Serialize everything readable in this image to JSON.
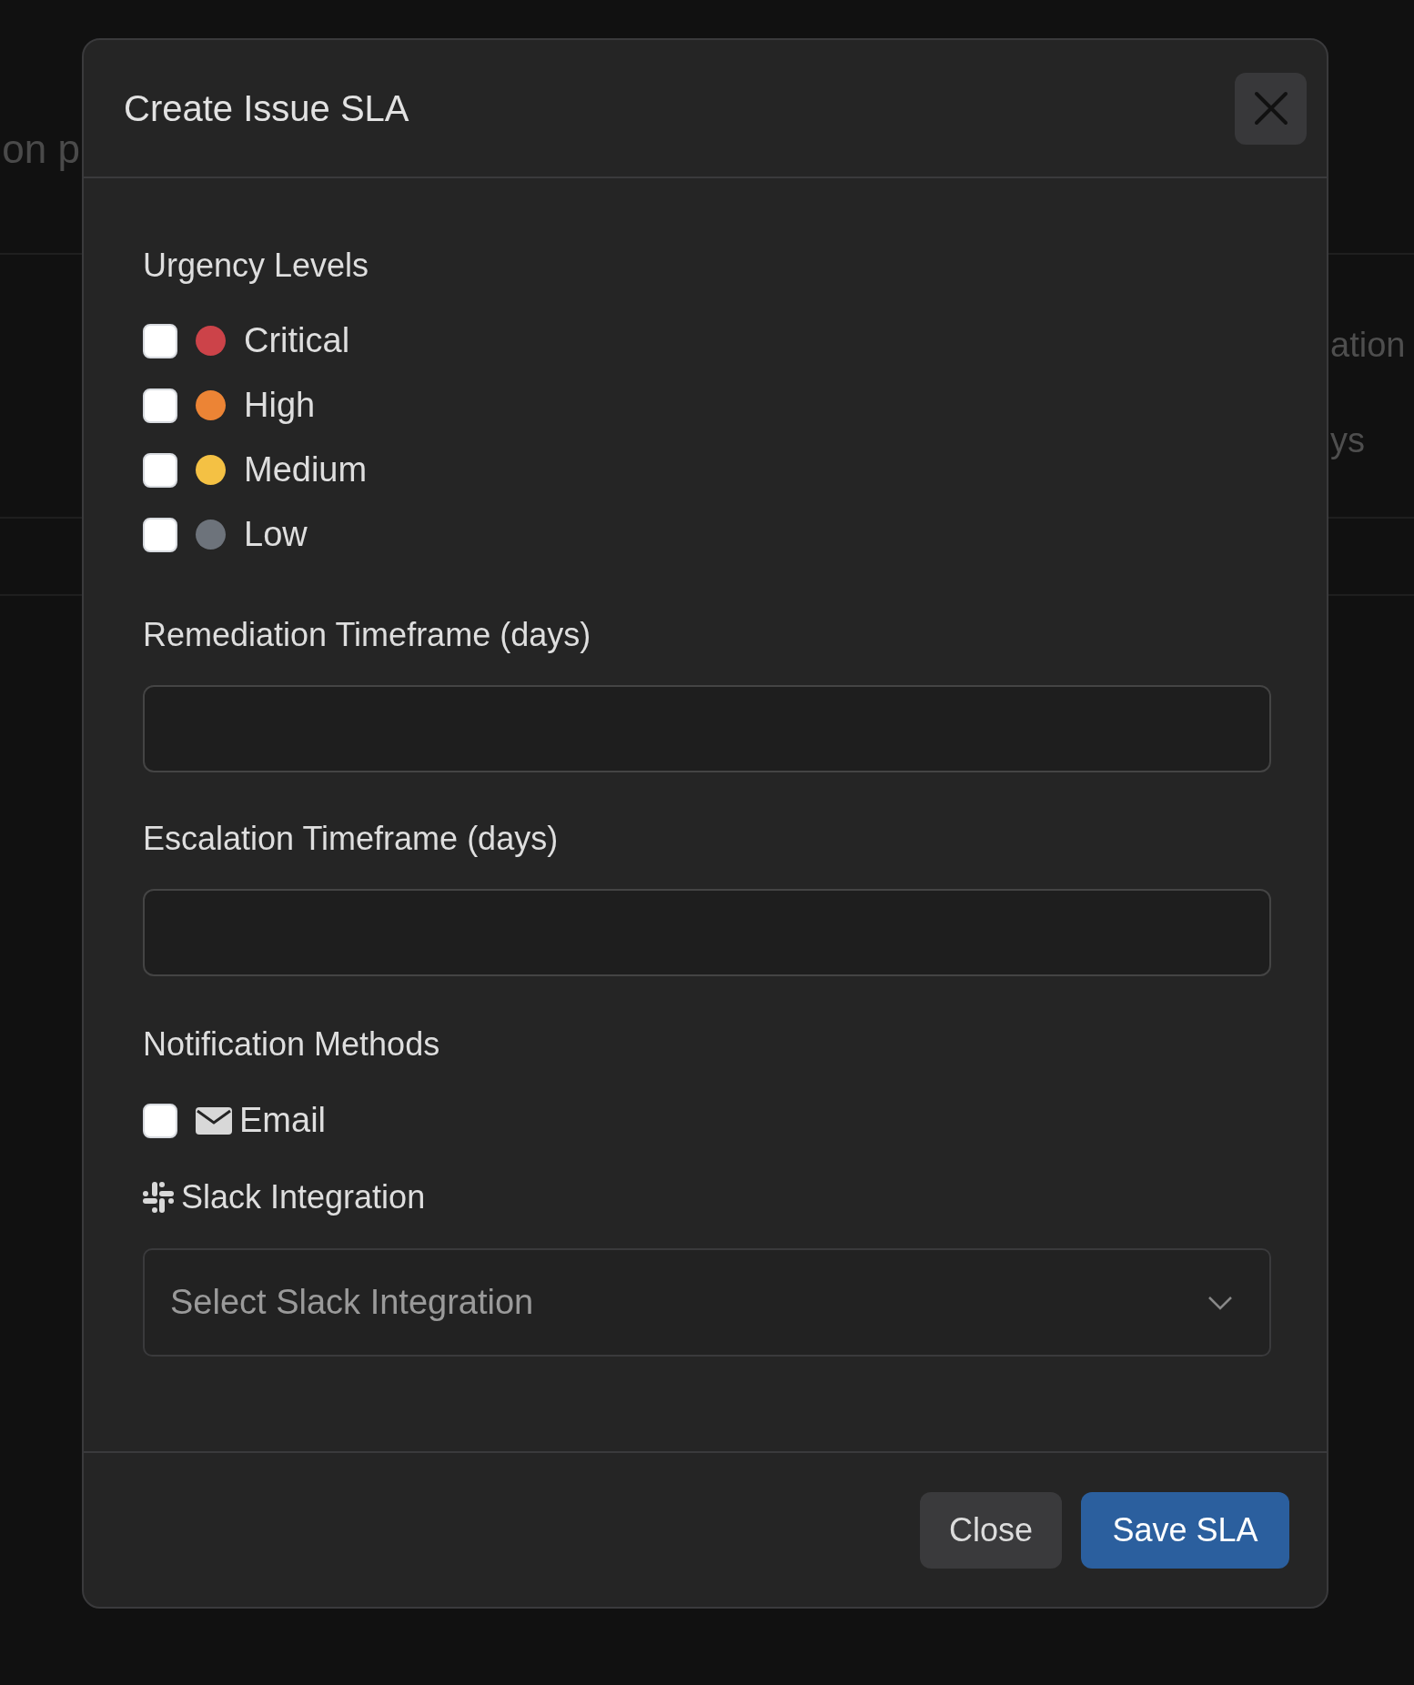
{
  "background": {
    "header_text": "on p",
    "row_texts": [
      "ation",
      "ys"
    ]
  },
  "modal": {
    "title": "Create Issue SLA",
    "urgency": {
      "label": "Urgency Levels",
      "levels": [
        {
          "label": "Critical",
          "color": "#cc4349",
          "checked": false
        },
        {
          "label": "High",
          "color": "#ec8435",
          "checked": false
        },
        {
          "label": "Medium",
          "color": "#f4c144",
          "checked": false
        },
        {
          "label": "Low",
          "color": "#6d737b",
          "checked": false
        }
      ]
    },
    "fields": [
      {
        "label": "Remediation Timeframe (days)"
      },
      {
        "label": "Escalation Timeframe (days)"
      }
    ],
    "notifications": {
      "label": "Notification Methods",
      "methods": [
        {
          "kind": "email",
          "label": "Email",
          "checked": false
        }
      ]
    },
    "slack": {
      "label": "Slack Integration",
      "placeholder": "Select Slack Integration"
    },
    "buttons": [
      {
        "kind": "secondary",
        "label": "Close"
      },
      {
        "kind": "primary",
        "label": "Save SLA"
      }
    ]
  }
}
